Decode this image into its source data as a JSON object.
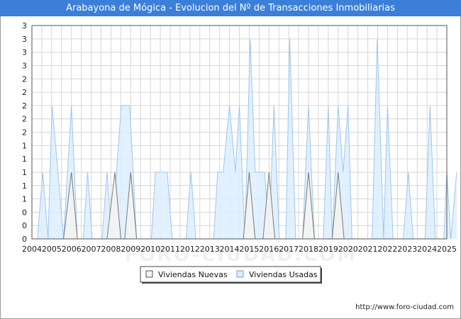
{
  "title": "Arabayona de Mógica - Evolucion del Nº de Transacciones Inmobiliarias",
  "watermark": "FORO-CIUDAD.COM",
  "footer": "http://www.foro-ciudad.com",
  "colors": {
    "header_bg": "#3b7fd9",
    "nuevas_fill": "#f2f2f2",
    "nuevas_line": "#7a7a7a",
    "usadas_fill": "#ddeeff",
    "usadas_line": "#9ec6ef"
  },
  "chart_data": {
    "type": "area",
    "x_range": [
      2004,
      2025
    ],
    "ylim": [
      0,
      3.2
    ],
    "ytick_labels": [
      "0",
      "0",
      "0",
      "1",
      "1",
      "1",
      "1",
      "1",
      "2",
      "2",
      "2",
      "2",
      "2",
      "3",
      "3",
      "3",
      "3"
    ],
    "xtick_labels": [
      "2004",
      "2005",
      "2006",
      "2007",
      "2008",
      "2009",
      "2010",
      "2011",
      "2012",
      "2013",
      "2014",
      "2015",
      "2016",
      "2017",
      "2018",
      "2019",
      "2020",
      "2021",
      "2022",
      "2023",
      "2024",
      "2025"
    ],
    "legend": {
      "position": "bottom",
      "entries": [
        "Viviendas Nuevas",
        "Viviendas Usadas"
      ]
    },
    "series": [
      {
        "name": "Viviendas Nuevas",
        "points": [
          [
            2004,
            0
          ],
          [
            2005.6,
            0
          ],
          [
            2006.0,
            1
          ],
          [
            2006.3,
            0
          ],
          [
            2007.8,
            0
          ],
          [
            2008.2,
            1
          ],
          [
            2008.5,
            0
          ],
          [
            2008.7,
            0
          ],
          [
            2009.0,
            1
          ],
          [
            2009.3,
            0
          ],
          [
            2014.7,
            0
          ],
          [
            2015.0,
            1
          ],
          [
            2015.3,
            0
          ],
          [
            2015.7,
            0
          ],
          [
            2016.0,
            1
          ],
          [
            2016.3,
            0
          ],
          [
            2017.7,
            0
          ],
          [
            2018.0,
            1
          ],
          [
            2018.3,
            0
          ],
          [
            2019.2,
            0
          ],
          [
            2019.5,
            1
          ],
          [
            2019.8,
            0
          ],
          [
            2025,
            0
          ]
        ]
      },
      {
        "name": "Viviendas Usadas",
        "points": [
          [
            2004,
            0
          ],
          [
            2004.28,
            0
          ],
          [
            2004.55,
            1
          ],
          [
            2004.82,
            0
          ],
          [
            2005.02,
            2
          ],
          [
            2005.32,
            1
          ],
          [
            2005.6,
            0
          ],
          [
            2006.0,
            2
          ],
          [
            2006.3,
            0
          ],
          [
            2006.6,
            0
          ],
          [
            2006.82,
            1
          ],
          [
            2007.05,
            0
          ],
          [
            2007.55,
            0
          ],
          [
            2007.8,
            1
          ],
          [
            2008.05,
            0
          ],
          [
            2008.52,
            2
          ],
          [
            2008.95,
            2
          ],
          [
            2009.3,
            0
          ],
          [
            2010.05,
            0
          ],
          [
            2010.25,
            1
          ],
          [
            2010.85,
            1
          ],
          [
            2011.1,
            0
          ],
          [
            2011.8,
            0
          ],
          [
            2012.05,
            1
          ],
          [
            2012.3,
            0
          ],
          [
            2013.2,
            0
          ],
          [
            2013.4,
            1
          ],
          [
            2013.68,
            1
          ],
          [
            2014.0,
            2
          ],
          [
            2014.3,
            1
          ],
          [
            2014.5,
            2
          ],
          [
            2014.78,
            0
          ],
          [
            2015.05,
            3
          ],
          [
            2015.3,
            1
          ],
          [
            2015.78,
            1
          ],
          [
            2016.0,
            0
          ],
          [
            2016.25,
            2
          ],
          [
            2016.52,
            0
          ],
          [
            2016.85,
            0
          ],
          [
            2017.05,
            3
          ],
          [
            2017.35,
            0
          ],
          [
            2017.7,
            0
          ],
          [
            2018.0,
            2
          ],
          [
            2018.3,
            0
          ],
          [
            2018.75,
            0
          ],
          [
            2019.0,
            2
          ],
          [
            2019.2,
            0
          ],
          [
            2019.5,
            2
          ],
          [
            2019.75,
            1
          ],
          [
            2020.0,
            2
          ],
          [
            2020.2,
            0
          ],
          [
            2021.22,
            0
          ],
          [
            2021.48,
            3
          ],
          [
            2021.8,
            0
          ],
          [
            2022.0,
            2
          ],
          [
            2022.28,
            0
          ],
          [
            2022.8,
            0
          ],
          [
            2023.05,
            1
          ],
          [
            2023.3,
            0
          ],
          [
            2023.9,
            0
          ],
          [
            2024.15,
            2
          ],
          [
            2024.42,
            0
          ],
          [
            2024.85,
            0
          ],
          [
            2025.0,
            1
          ],
          [
            2025.2,
            0
          ],
          [
            2025.5,
            1
          ]
        ]
      }
    ]
  }
}
